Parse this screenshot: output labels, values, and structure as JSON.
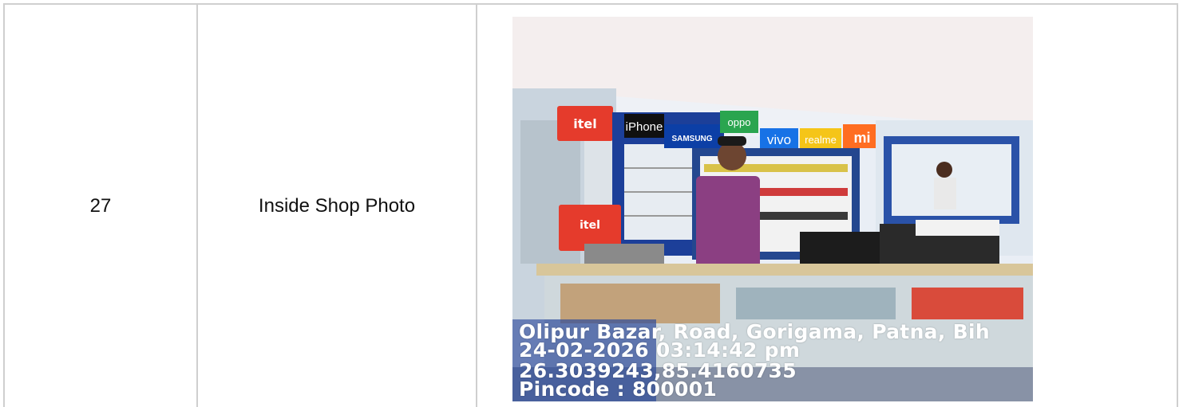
{
  "row": {
    "number": "27",
    "label": "Inside Shop Photo"
  },
  "photo": {
    "brands": [
      "iPhone",
      "SAMSUNG",
      "vivo",
      "realme",
      "mi",
      "itel",
      "oppo"
    ],
    "overlay": {
      "address": "Olipur Bazar, Road, Gorigama, Patna, Bih",
      "datetime": "24-02-2026 03:14:42 pm",
      "coords": "26.3039243,85.4160735",
      "pincode": "Pincode : 800001"
    }
  }
}
